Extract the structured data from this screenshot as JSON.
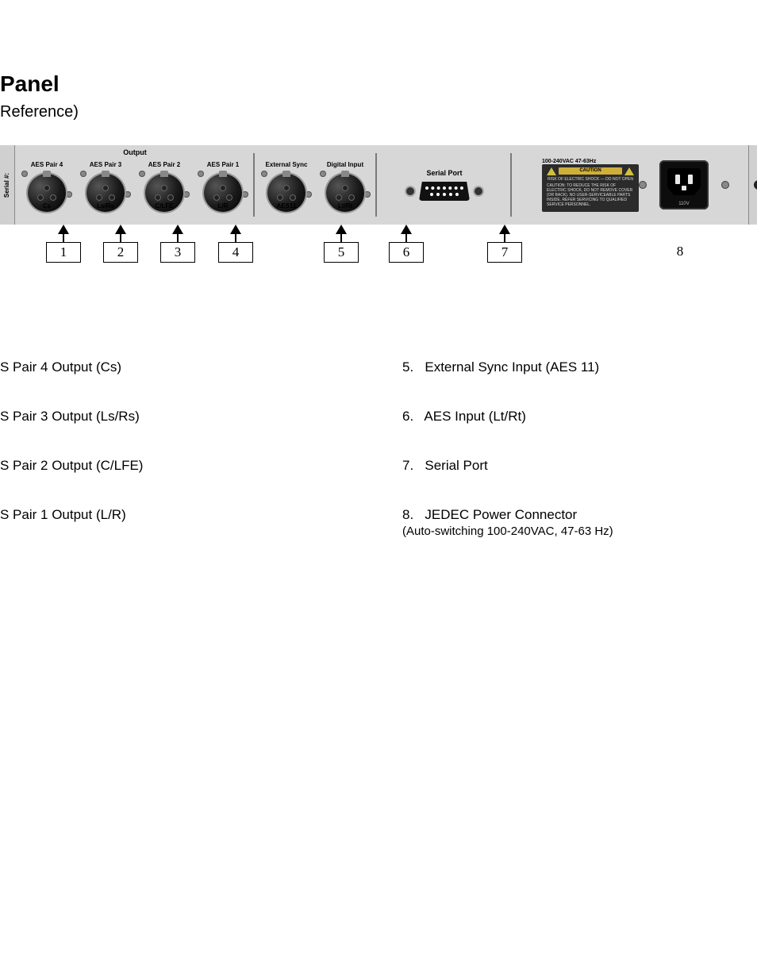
{
  "headings": {
    "title": "Panel",
    "subtitle": "Reference)"
  },
  "panel": {
    "serial_edge": "Serial #:",
    "output_group_title": "Output",
    "outputs": [
      {
        "n": 1,
        "top": "AES Pair 4",
        "bottom": "Cs"
      },
      {
        "n": 2,
        "top": "AES Pair 3",
        "bottom": "Ls/Rs"
      },
      {
        "n": 3,
        "top": "AES Pair 2",
        "bottom": "C/LFE"
      },
      {
        "n": 4,
        "top": "AES Pair 1",
        "bottom": "L/R"
      }
    ],
    "ext_sync": {
      "n": 5,
      "top": "External Sync",
      "bottom": "AES11"
    },
    "digital_in": {
      "n": 6,
      "top": "Digital Input",
      "bottom": "Lt/Rt"
    },
    "serial_port": {
      "n": 7,
      "label": "Serial Port"
    },
    "power": {
      "n": 8,
      "spec_line": "100-240VAC 47-63Hz",
      "caution_word": "CAUTION",
      "caution_sub": "RISK OF ELECTRIC SHOCK — DO NOT OPEN",
      "caution_body": "CAUTION: TO REDUCE THE RISK OF ELECTRIC SHOCK, DO NOT REMOVE COVER (OR BACK). NO USER-SERVICEABLE PARTS INSIDE. REFER SERVICING TO QUALIFIED SERVICE PERSONNEL.",
      "socket_label": "110V"
    }
  },
  "callouts": [
    "1",
    "2",
    "3",
    "4",
    "5",
    "6",
    "7",
    "8"
  ],
  "desc": {
    "left": [
      "S Pair 4 Output (Cs)",
      "S Pair 3 Output (Ls/Rs)",
      "S Pair 2 Output (C/LFE)",
      "S Pair 1 Output (L/R)"
    ],
    "right": [
      {
        "num": "5.",
        "text": "External Sync Input (AES 11)"
      },
      {
        "num": "6.",
        "text": "AES Input (Lt/Rt)"
      },
      {
        "num": "7.",
        "text": "Serial Port"
      },
      {
        "num": "8.",
        "text": "JEDEC Power Connector",
        "note": "(Auto-switching 100-240VAC, 47-63 Hz)"
      }
    ]
  }
}
